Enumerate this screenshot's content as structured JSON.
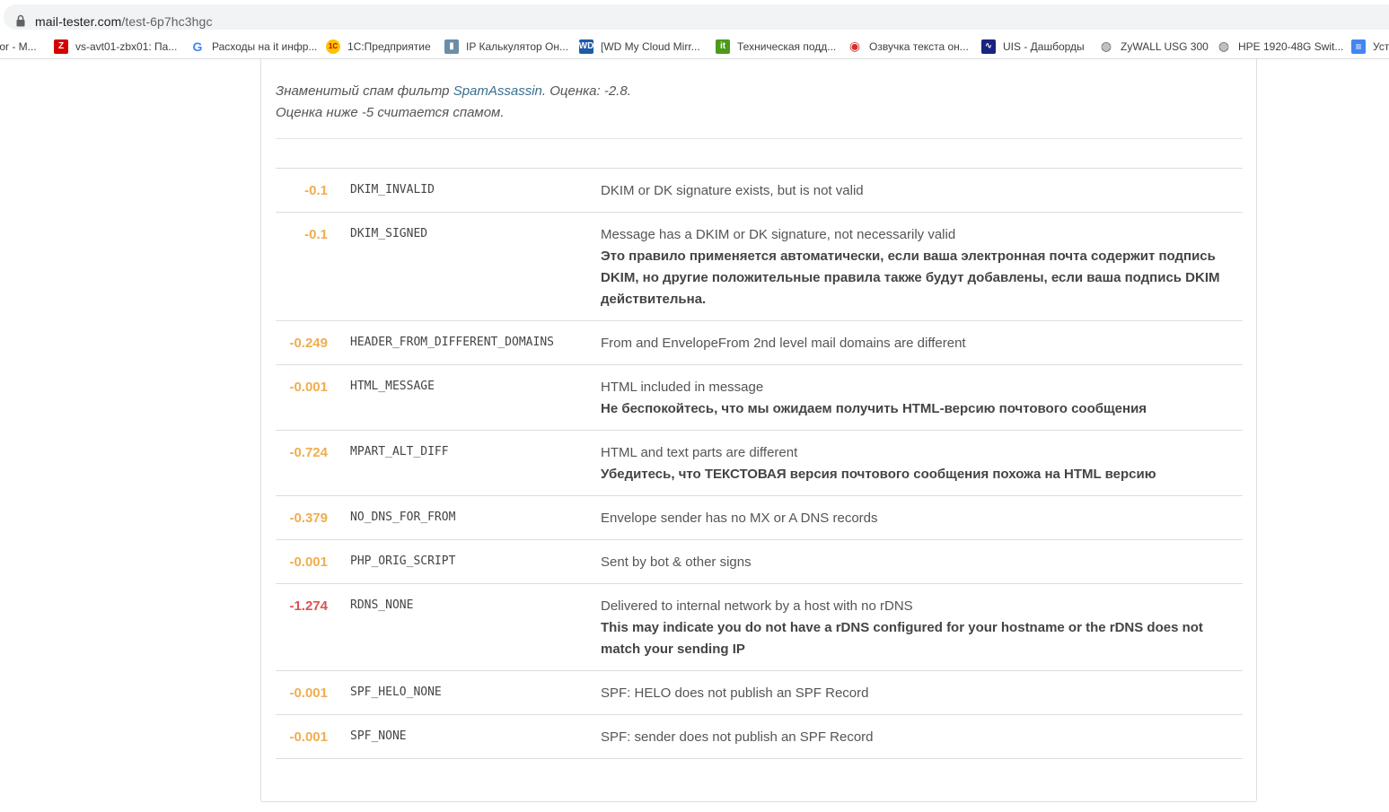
{
  "browser": {
    "url_host": "mail-tester.com",
    "url_path": "/test-6p7hc3hgc"
  },
  "bookmarks": [
    {
      "label": "tor - M...",
      "icon": "page-icon",
      "color": "#5f6368"
    },
    {
      "label": "vs-avt01-zbx01: Па...",
      "icon": "zabbix-icon",
      "color": "#d40000"
    },
    {
      "label": "Расходы на it инфр...",
      "icon": "google-icon",
      "color": "#4285f4"
    },
    {
      "label": "1С:Предприятие",
      "icon": "1c-icon",
      "color": "#f9c400"
    },
    {
      "label": "IP Калькулятор Он...",
      "icon": "network-icon",
      "color": "#6b8ea8"
    },
    {
      "label": "[WD My Cloud Mirr...",
      "icon": "wd-icon",
      "color": "#1d5aa8"
    },
    {
      "label": "Техническая подд...",
      "icon": "it-icon",
      "color": "#4c9a1a"
    },
    {
      "label": "Озвучка текста он...",
      "icon": "speech-icon",
      "color": "#d32f2f"
    },
    {
      "label": "UIS - Дашборды",
      "icon": "uis-icon",
      "color": "#1a237e"
    },
    {
      "label": "ZyWALL USG 300",
      "icon": "globe-icon",
      "color": "#5f6368"
    },
    {
      "label": "HPE 1920-48G Swit...",
      "icon": "globe-icon",
      "color": "#5f6368"
    },
    {
      "label": "Уст",
      "icon": "doc-icon",
      "color": "#4285f4"
    }
  ],
  "intro": {
    "prefix": "Знаменитый спам фильтр ",
    "link": "SpamAssassin",
    "suffix": ". Оценка: -2.8.",
    "line2": "Оценка ниже -5 считается спамом."
  },
  "rules": [
    {
      "score": "-0.1",
      "name": "DKIM_INVALID",
      "desc": "DKIM or DK signature exists, but is not valid",
      "tip": "",
      "severity": "warn"
    },
    {
      "score": "-0.1",
      "name": "DKIM_SIGNED",
      "desc": "Message has a DKIM or DK signature, not necessarily valid",
      "tip": "Это правило применяется автоматически, если ваша электронная почта содержит подпись DKIM, но другие положительные правила также будут добавлены, если ваша подпись DKIM действительна.",
      "severity": "warn"
    },
    {
      "score": "-0.249",
      "name": "HEADER_FROM_DIFFERENT_DOMAINS",
      "desc": "From and EnvelopeFrom 2nd level mail domains are different",
      "tip": "",
      "severity": "warn"
    },
    {
      "score": "-0.001",
      "name": "HTML_MESSAGE",
      "desc": "HTML included in message",
      "tip": "Не беспокойтесь, что мы ожидаем получить HTML-версию почтового сообщения",
      "severity": "warn"
    },
    {
      "score": "-0.724",
      "name": "MPART_ALT_DIFF",
      "desc": "HTML and text parts are different",
      "tip": "Убедитесь, что ТЕКСТОВАЯ версия почтового сообщения похожа на HTML версию",
      "severity": "warn"
    },
    {
      "score": "-0.379",
      "name": "NO_DNS_FOR_FROM",
      "desc": "Envelope sender has no MX or A DNS records",
      "tip": "",
      "severity": "warn"
    },
    {
      "score": "-0.001",
      "name": "PHP_ORIG_SCRIPT",
      "desc": "Sent by bot & other signs",
      "tip": "",
      "severity": "warn"
    },
    {
      "score": "-1.274",
      "name": "RDNS_NONE",
      "desc": "Delivered to internal network by a host with no rDNS",
      "tip": "This may indicate you do not have a rDNS configured for your hostname or the rDNS does not match your sending IP",
      "severity": "danger"
    },
    {
      "score": "-0.001",
      "name": "SPF_HELO_NONE",
      "desc": "SPF: HELO does not publish an SPF Record",
      "tip": "",
      "severity": "warn"
    },
    {
      "score": "-0.001",
      "name": "SPF_NONE",
      "desc": "SPF: sender does not publish an SPF Record",
      "tip": "",
      "severity": "warn"
    }
  ],
  "colors": {
    "warn": "#f0ad4e",
    "danger": "#d9534f"
  }
}
